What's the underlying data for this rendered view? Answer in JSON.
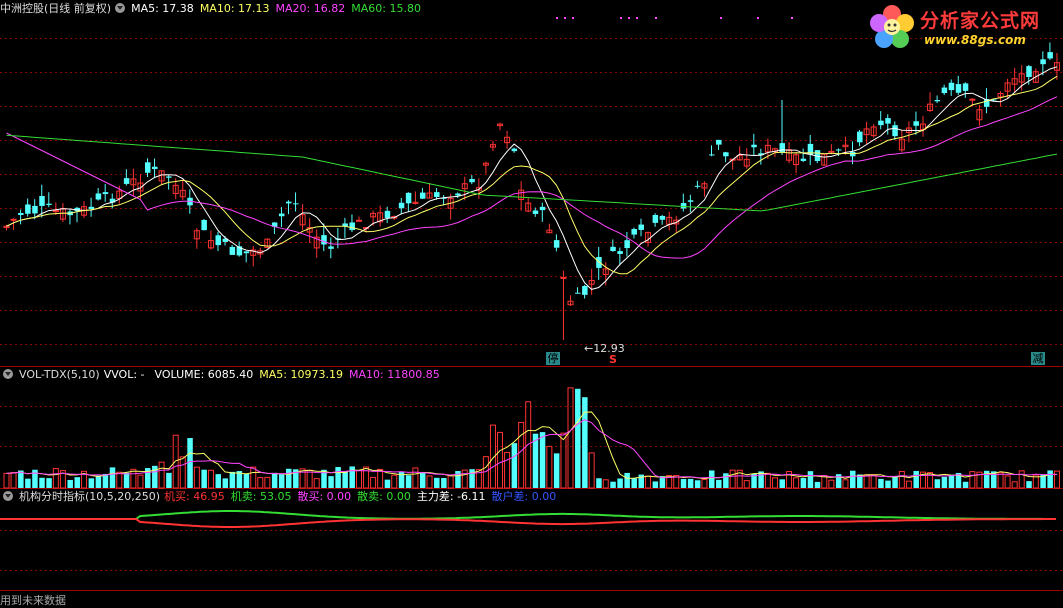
{
  "main_panel": {
    "title": "中洲控股(日线 前复权)",
    "ma_labels": [
      {
        "text": "MA5: 17.38",
        "color": "#ffffff"
      },
      {
        "text": "MA10: 17.13",
        "color": "#ffff66"
      },
      {
        "text": "MA20: 16.82",
        "color": "#ff44ff"
      },
      {
        "text": "MA60: 15.80",
        "color": "#33dd33"
      }
    ],
    "low_marker": "12.93",
    "markers": {
      "ting": "停",
      "s": "S",
      "jian": "减"
    }
  },
  "vol_panel": {
    "title": "VOL-TDX(5,10)",
    "labels": [
      {
        "text": "VVOL: -",
        "color": "#ffffff"
      },
      {
        "text": "VOLUME: 6085.40",
        "color": "#ffffff"
      },
      {
        "text": "MA5: 10973.19",
        "color": "#ffff66"
      },
      {
        "text": "MA10: 11800.85",
        "color": "#ff44ff"
      }
    ]
  },
  "ind_panel": {
    "title": "机构分时指标(10,5,20,250)",
    "labels": [
      {
        "text": "机买: 46.95",
        "color": "#ff3333"
      },
      {
        "text": "机卖: 53.05",
        "color": "#33dd33"
      },
      {
        "text": "散买: 0.00",
        "color": "#ff44ff"
      },
      {
        "text": "散卖: 0.00",
        "color": "#33dd33"
      },
      {
        "text": "主力差: -6.11",
        "color": "#ffffff"
      },
      {
        "text": "散户差: 0.00",
        "color": "#3355ff"
      }
    ]
  },
  "logo": {
    "main": "分析家公式网",
    "sub": "www.88gs.com"
  },
  "bottom_text": "用到未来数据",
  "colors": {
    "up": "#ff3333",
    "down": "#54ffff",
    "grid": "#8b0000",
    "border": "#a00000"
  }
}
